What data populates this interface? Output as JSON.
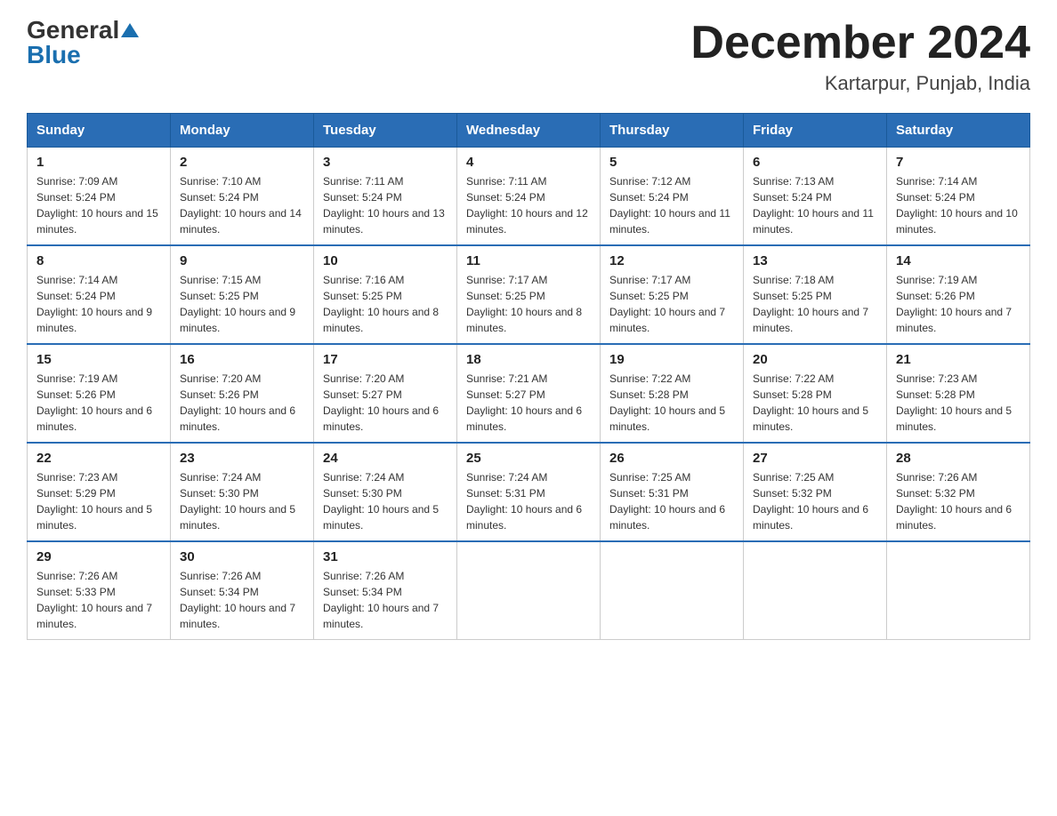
{
  "logo": {
    "general": "General",
    "blue": "Blue"
  },
  "title": {
    "month": "December 2024",
    "location": "Kartarpur, Punjab, India"
  },
  "weekdays": [
    "Sunday",
    "Monday",
    "Tuesday",
    "Wednesday",
    "Thursday",
    "Friday",
    "Saturday"
  ],
  "weeks": [
    [
      {
        "day": "1",
        "sunrise": "7:09 AM",
        "sunset": "5:24 PM",
        "daylight": "10 hours and 15 minutes."
      },
      {
        "day": "2",
        "sunrise": "7:10 AM",
        "sunset": "5:24 PM",
        "daylight": "10 hours and 14 minutes."
      },
      {
        "day": "3",
        "sunrise": "7:11 AM",
        "sunset": "5:24 PM",
        "daylight": "10 hours and 13 minutes."
      },
      {
        "day": "4",
        "sunrise": "7:11 AM",
        "sunset": "5:24 PM",
        "daylight": "10 hours and 12 minutes."
      },
      {
        "day": "5",
        "sunrise": "7:12 AM",
        "sunset": "5:24 PM",
        "daylight": "10 hours and 11 minutes."
      },
      {
        "day": "6",
        "sunrise": "7:13 AM",
        "sunset": "5:24 PM",
        "daylight": "10 hours and 11 minutes."
      },
      {
        "day": "7",
        "sunrise": "7:14 AM",
        "sunset": "5:24 PM",
        "daylight": "10 hours and 10 minutes."
      }
    ],
    [
      {
        "day": "8",
        "sunrise": "7:14 AM",
        "sunset": "5:24 PM",
        "daylight": "10 hours and 9 minutes."
      },
      {
        "day": "9",
        "sunrise": "7:15 AM",
        "sunset": "5:25 PM",
        "daylight": "10 hours and 9 minutes."
      },
      {
        "day": "10",
        "sunrise": "7:16 AM",
        "sunset": "5:25 PM",
        "daylight": "10 hours and 8 minutes."
      },
      {
        "day": "11",
        "sunrise": "7:17 AM",
        "sunset": "5:25 PM",
        "daylight": "10 hours and 8 minutes."
      },
      {
        "day": "12",
        "sunrise": "7:17 AM",
        "sunset": "5:25 PM",
        "daylight": "10 hours and 7 minutes."
      },
      {
        "day": "13",
        "sunrise": "7:18 AM",
        "sunset": "5:25 PM",
        "daylight": "10 hours and 7 minutes."
      },
      {
        "day": "14",
        "sunrise": "7:19 AM",
        "sunset": "5:26 PM",
        "daylight": "10 hours and 7 minutes."
      }
    ],
    [
      {
        "day": "15",
        "sunrise": "7:19 AM",
        "sunset": "5:26 PM",
        "daylight": "10 hours and 6 minutes."
      },
      {
        "day": "16",
        "sunrise": "7:20 AM",
        "sunset": "5:26 PM",
        "daylight": "10 hours and 6 minutes."
      },
      {
        "day": "17",
        "sunrise": "7:20 AM",
        "sunset": "5:27 PM",
        "daylight": "10 hours and 6 minutes."
      },
      {
        "day": "18",
        "sunrise": "7:21 AM",
        "sunset": "5:27 PM",
        "daylight": "10 hours and 6 minutes."
      },
      {
        "day": "19",
        "sunrise": "7:22 AM",
        "sunset": "5:28 PM",
        "daylight": "10 hours and 5 minutes."
      },
      {
        "day": "20",
        "sunrise": "7:22 AM",
        "sunset": "5:28 PM",
        "daylight": "10 hours and 5 minutes."
      },
      {
        "day": "21",
        "sunrise": "7:23 AM",
        "sunset": "5:28 PM",
        "daylight": "10 hours and 5 minutes."
      }
    ],
    [
      {
        "day": "22",
        "sunrise": "7:23 AM",
        "sunset": "5:29 PM",
        "daylight": "10 hours and 5 minutes."
      },
      {
        "day": "23",
        "sunrise": "7:24 AM",
        "sunset": "5:30 PM",
        "daylight": "10 hours and 5 minutes."
      },
      {
        "day": "24",
        "sunrise": "7:24 AM",
        "sunset": "5:30 PM",
        "daylight": "10 hours and 5 minutes."
      },
      {
        "day": "25",
        "sunrise": "7:24 AM",
        "sunset": "5:31 PM",
        "daylight": "10 hours and 6 minutes."
      },
      {
        "day": "26",
        "sunrise": "7:25 AM",
        "sunset": "5:31 PM",
        "daylight": "10 hours and 6 minutes."
      },
      {
        "day": "27",
        "sunrise": "7:25 AM",
        "sunset": "5:32 PM",
        "daylight": "10 hours and 6 minutes."
      },
      {
        "day": "28",
        "sunrise": "7:26 AM",
        "sunset": "5:32 PM",
        "daylight": "10 hours and 6 minutes."
      }
    ],
    [
      {
        "day": "29",
        "sunrise": "7:26 AM",
        "sunset": "5:33 PM",
        "daylight": "10 hours and 7 minutes."
      },
      {
        "day": "30",
        "sunrise": "7:26 AM",
        "sunset": "5:34 PM",
        "daylight": "10 hours and 7 minutes."
      },
      {
        "day": "31",
        "sunrise": "7:26 AM",
        "sunset": "5:34 PM",
        "daylight": "10 hours and 7 minutes."
      },
      null,
      null,
      null,
      null
    ]
  ]
}
